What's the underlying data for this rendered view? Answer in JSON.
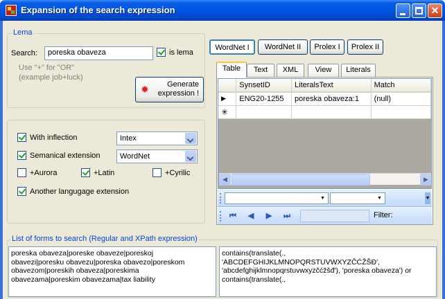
{
  "window": {
    "title": "Expansion of the search expression"
  },
  "lema": {
    "group_title": "Lema",
    "search_label": "Search:",
    "search_value": "poreska obaveza",
    "is_lema_label": "is lema",
    "is_lema_checked": true,
    "hint_line1": "Use \"+\" for \"OR\"",
    "hint_line2": "(example job+luck)",
    "generate_label": "Generate\nexpression !"
  },
  "options": {
    "with_inflection_label": "With inflection",
    "with_inflection_checked": true,
    "inflection_value": "Intex",
    "semantical_label": "Semanical extension",
    "semantical_checked": true,
    "semantical_value": "WordNet",
    "aurora_label": "+Aurora",
    "aurora_checked": false,
    "latin_label": "+Latin",
    "latin_checked": true,
    "cyrilic_label": "+Cyrilic",
    "cyrilic_checked": false,
    "another_label": "Another langugage extension",
    "another_checked": true
  },
  "sources": [
    "WordNet I",
    "WordNet II",
    "Prolex I",
    "Prolex II"
  ],
  "tabs": [
    "Table",
    "Text",
    "XML",
    "View",
    "Literals"
  ],
  "grid": {
    "columns": [
      "SynsetID",
      "LiteralsText",
      "Match"
    ],
    "rows": [
      {
        "synset_id": "ENG20-1255",
        "literals_text": "poreska obaveza:1",
        "match": "(null)"
      }
    ]
  },
  "navigator": {
    "filter_label": "Filter:"
  },
  "forms": {
    "group_title": "List  of forms to search  (Regular and XPath expression)",
    "regular": "poreska obaveza|poreske obaveze|poreskoj\nobavezi|poresku obavezu|poreska obavezo|poreskom\nobavezom|poreskih obaveza|poreskima\nobavezama|poreskim obavezama|tax liability",
    "xpath": "contains(translate(.,\n'ABCDEFGHIJKLMNOPQRSTUVWXYZČĆŽŠĐ',\n'abcdefghijklmnopqrstuvwxyzčćžšđ'), 'poreska obaveza') or\ncontains(translate(.,"
  }
}
